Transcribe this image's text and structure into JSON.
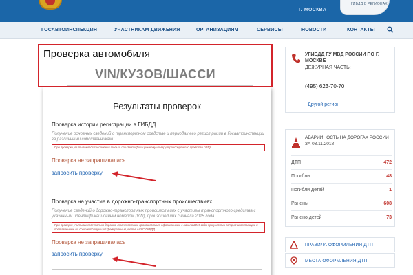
{
  "header": {
    "city": "Г. МОСКВА",
    "region_label": "ГИБДД В РЕГИОНАХ"
  },
  "nav": {
    "items": [
      {
        "label": "ГОСАВТОИНСПЕКЦИЯ"
      },
      {
        "label": "УЧАСТНИКАМ ДВИЖЕНИЯ"
      },
      {
        "label": "ОРГАНИЗАЦИЯМ"
      },
      {
        "label": "СЕРВИСЫ"
      },
      {
        "label": "НОВОСТИ"
      },
      {
        "label": "КОНТАКТЫ"
      }
    ],
    "search_icon": "search-icon"
  },
  "highlight": {
    "title": "Проверка автомобиля",
    "subtitle": "VIN/КУЗОВ/ШАССИ"
  },
  "results": {
    "title": "Результаты проверок",
    "sections": [
      {
        "title": "Проверка истории регистрации в ГИБДД",
        "description": "Получение основных сведений о транспортном средстве и периодах его регистрации в Госавтоинспекции за различными собственниками",
        "note": "При проверке учитываются совпадения только по идентификационному номеру транспортного средства (VIN)",
        "status": "Проверка не запрашивалась",
        "link": "запросить проверку"
      },
      {
        "title": "Проверка на участие в дорожно-транспортных происшествиях",
        "description": "Получение сведений о дорожно-транспортных происшествиях с участием транспортного средства с указанным идентификационным номером (VIN), произошедших с начала 2015 года",
        "note": "При проверке учитываются только дорожно-транспортные происшествия, оформленные с начала 2015 года при участии сотрудников полиции и поставленные на соответствующий федеральный учет в АИУС ГИБДД",
        "status": "Проверка не запрашивалась",
        "link": "запросить проверку"
      }
    ]
  },
  "contact": {
    "title": "УГИБДД ГУ МВД РОССИИ ПО Г. МОСКВЕ",
    "duty_label": "ДЕЖУРНАЯ ЧАСТЬ:",
    "phone": "(495) 623-70-70",
    "other_region": "Другой регион"
  },
  "accidents": {
    "title": "АВАРИЙНОСТЬ НА ДОРОГАХ РОССИИ ЗА 03.11.2018",
    "rows": [
      {
        "label": "ДТП",
        "value": "472"
      },
      {
        "label": "Погибли",
        "value": "48"
      },
      {
        "label": "Погибли детей",
        "value": "1"
      },
      {
        "label": "Ранены",
        "value": "608"
      },
      {
        "label": "Ранено детей",
        "value": "73"
      }
    ]
  },
  "links": [
    {
      "label": "ПРАВИЛА ОФОРМЛЕНИЯ ДТП"
    },
    {
      "label": "МЕСТА ОФОРМЛЕНИЯ ДТП"
    }
  ],
  "colors": {
    "brand_blue": "#1b66a8",
    "accent_red": "#d3242b",
    "link_blue": "#1e62b0"
  }
}
